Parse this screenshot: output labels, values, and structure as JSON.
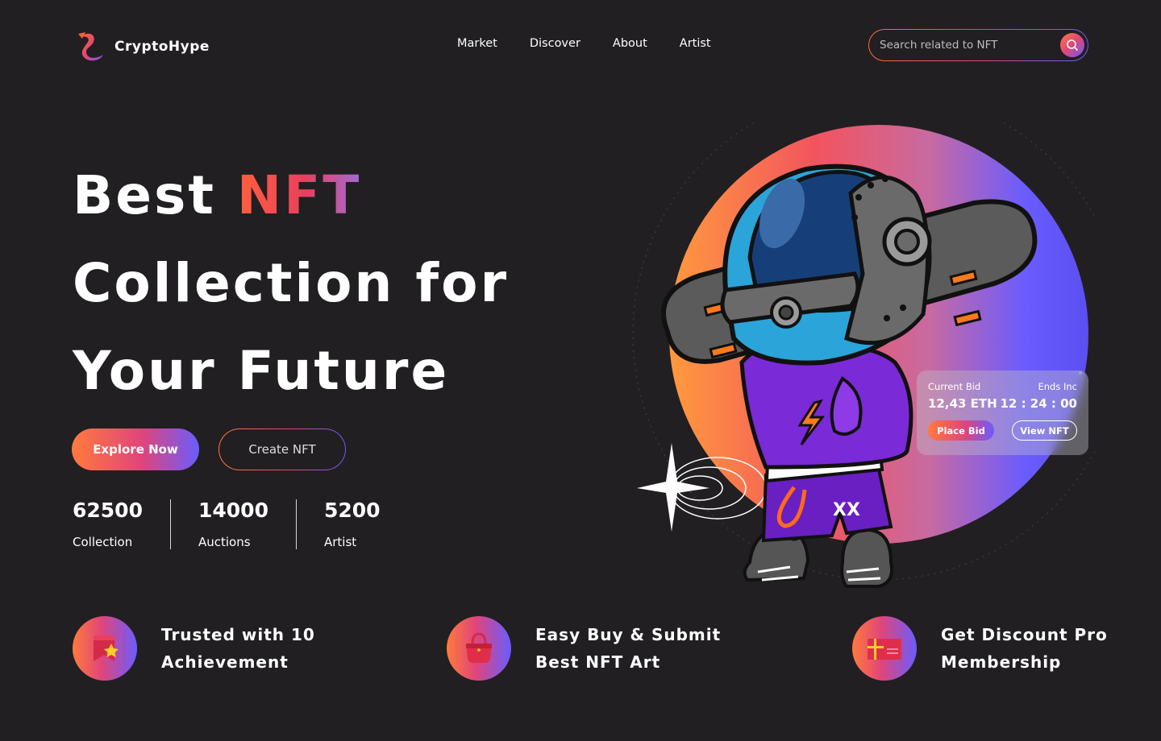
{
  "brand": {
    "name": "CryptoHype"
  },
  "nav": {
    "items": [
      "Market",
      "Discover",
      "About",
      "Artist"
    ]
  },
  "search": {
    "placeholder": "Search related to NFT"
  },
  "hero": {
    "line1_plain": "Best ",
    "line1_accent": "NFT",
    "line2": "Collection for",
    "line3": "Your Future",
    "explore_label": "Explore Now",
    "create_label": "Create NFT"
  },
  "stats": [
    {
      "value": "62500",
      "label": "Collection"
    },
    {
      "value": "14000",
      "label": "Auctions"
    },
    {
      "value": "5200",
      "label": "Artist"
    }
  ],
  "bid_card": {
    "current_bid_label": "Current Bid",
    "current_bid_value": "12,43 ETH",
    "ends_label": "Ends Inc",
    "ends_value": "12 : 24 : 00",
    "place_bid_label": "Place Bid",
    "view_nft_label": "View NFT"
  },
  "features": [
    {
      "line1": "Trusted with 10",
      "line2": "Achievement",
      "icon": "badge-star-icon"
    },
    {
      "line1": "Easy Buy & Submit",
      "line2": "Best NFT Art",
      "icon": "shopping-bag-icon"
    },
    {
      "line1": "Get Discount Pro",
      "line2": "Membership",
      "icon": "gift-card-icon"
    }
  ],
  "colors": {
    "background": "#211f22",
    "accent_start": "#ff7a3d",
    "accent_mid": "#e0457a",
    "accent_end": "#6a5cff"
  }
}
